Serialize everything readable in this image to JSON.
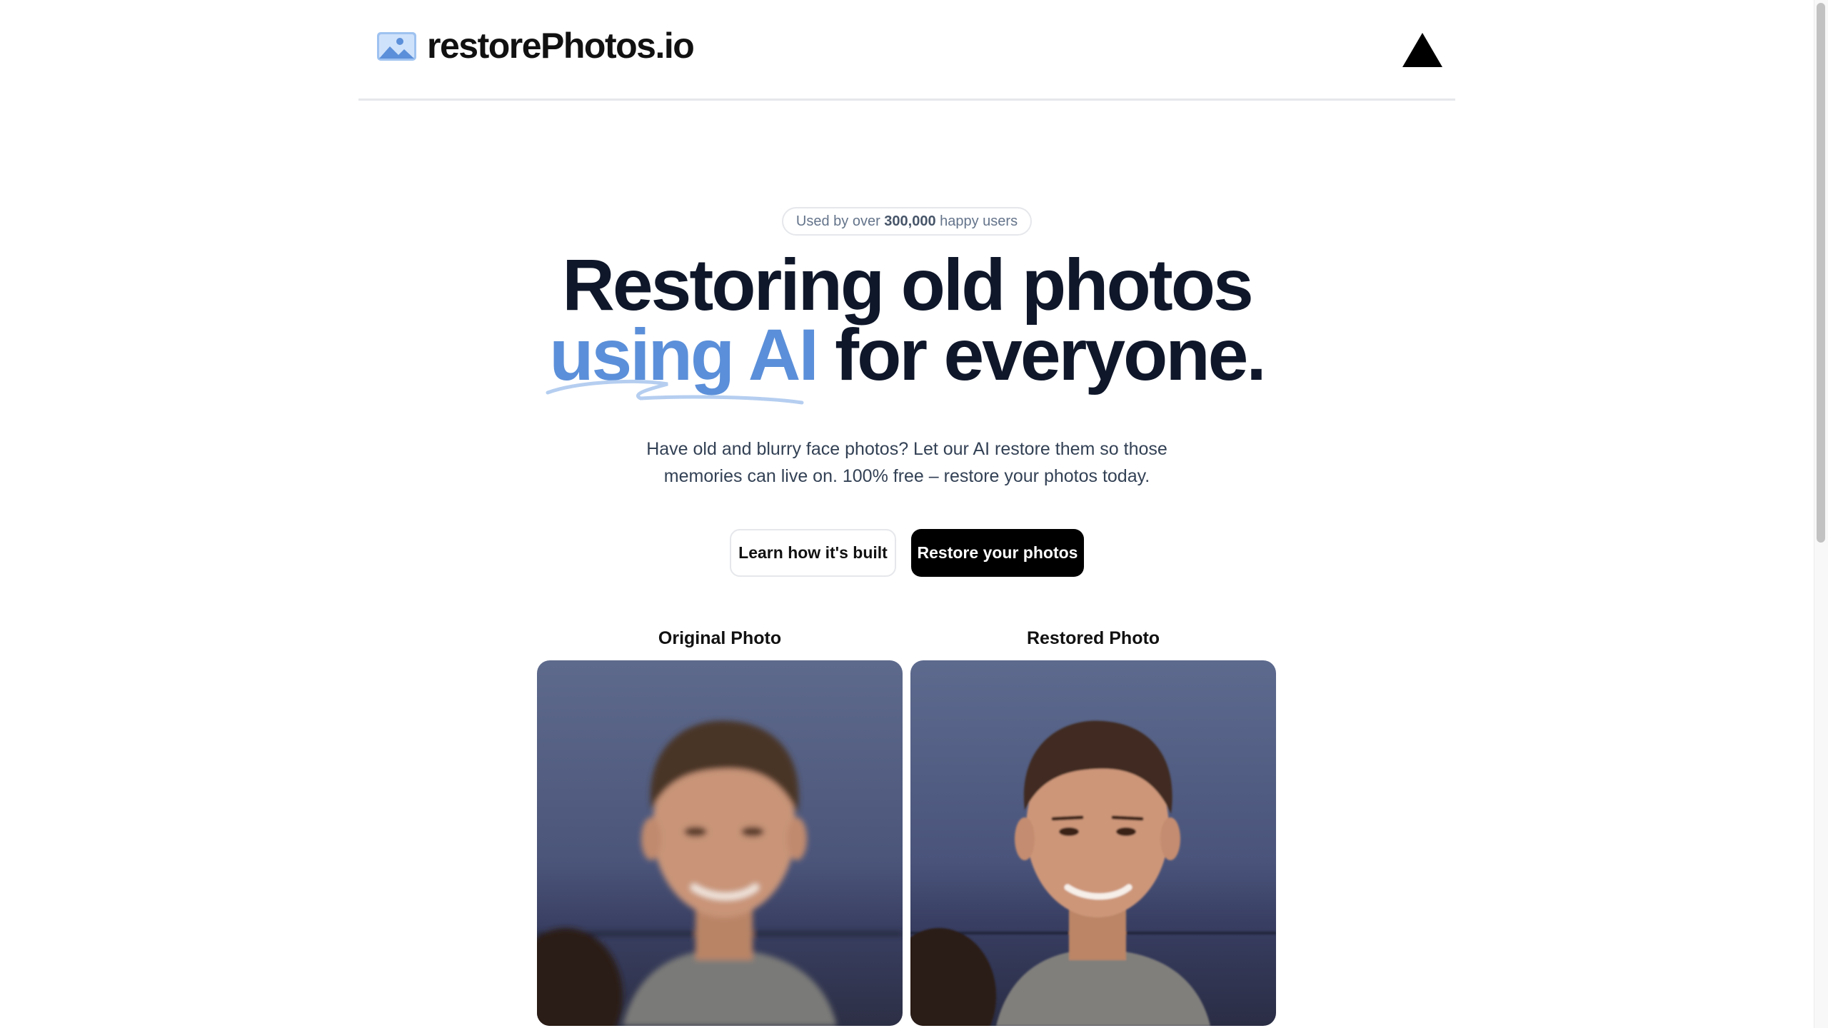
{
  "header": {
    "logo_text": "restorePhotos.io",
    "logo_icon": "image-icon",
    "github_icon": "vercel-triangle-icon"
  },
  "badge": {
    "prefix": "Used by over ",
    "count": "300,000",
    "suffix": " happy users"
  },
  "hero": {
    "line1": "Restoring old photos",
    "highlight": "using AI",
    "line2_rest": " for everyone."
  },
  "subtitle": "Have old and blurry face photos? Let our AI restore them so those memories can live on. 100% free – restore your photos today.",
  "buttons": {
    "learn_label": "Learn how it's built",
    "restore_label": "Restore your photos"
  },
  "comparison": {
    "original_label": "Original Photo",
    "restored_label": "Restored Photo"
  },
  "colors": {
    "accent": "#5b8fd9",
    "primary_button": "#000000",
    "text": "#0f172a"
  }
}
